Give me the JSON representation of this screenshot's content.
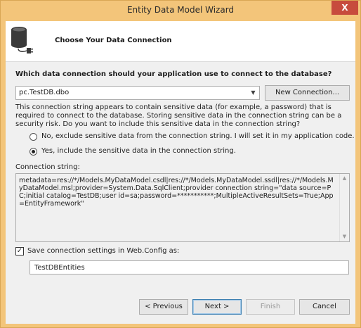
{
  "window": {
    "title": "Entity Data Model Wizard",
    "close_label": "X"
  },
  "header": {
    "title": "Choose Your Data Connection",
    "icon": "database-connection-icon"
  },
  "question": "Which data connection should your application use to connect to the database?",
  "connection_combo": {
    "value": "pc.TestDB.dbo",
    "arrow": "▼"
  },
  "new_connection_button": "New Connection...",
  "sensitive_note": "This connection string appears to contain sensitive data (for example, a password) that is required to connect to the database. Storing sensitive data in the connection string can be a security risk. Do you want to include this sensitive data in the connection string?",
  "radio_options": [
    {
      "label": "No, exclude sensitive data from the connection string. I will set it in my application code.",
      "checked": false
    },
    {
      "label": "Yes, include the sensitive data in the connection string.",
      "checked": true
    }
  ],
  "connection_string": {
    "label": "Connection string:",
    "value": "metadata=res://*/Models.MyDataModel.csdl|res://*/Models.MyDataModel.ssdl|res://*/Models.MyDataModel.msl;provider=System.Data.SqlClient;provider connection string=\"data source=PC;initial catalog=TestDB;user id=sa;password=***********;MultipleActiveResultSets=True;App=EntityFramework\""
  },
  "save_settings": {
    "label": "Save connection settings in Web.Config as:",
    "checked": true,
    "check_mark": "✓",
    "value": "TestDBEntities"
  },
  "buttons": {
    "previous": "< Previous",
    "next": "Next >",
    "finish": "Finish",
    "cancel": "Cancel"
  },
  "colors": {
    "title_bar": "#f3c57a",
    "close": "#c74b3d",
    "client": "#f0f0f0",
    "header": "#ffffff"
  }
}
